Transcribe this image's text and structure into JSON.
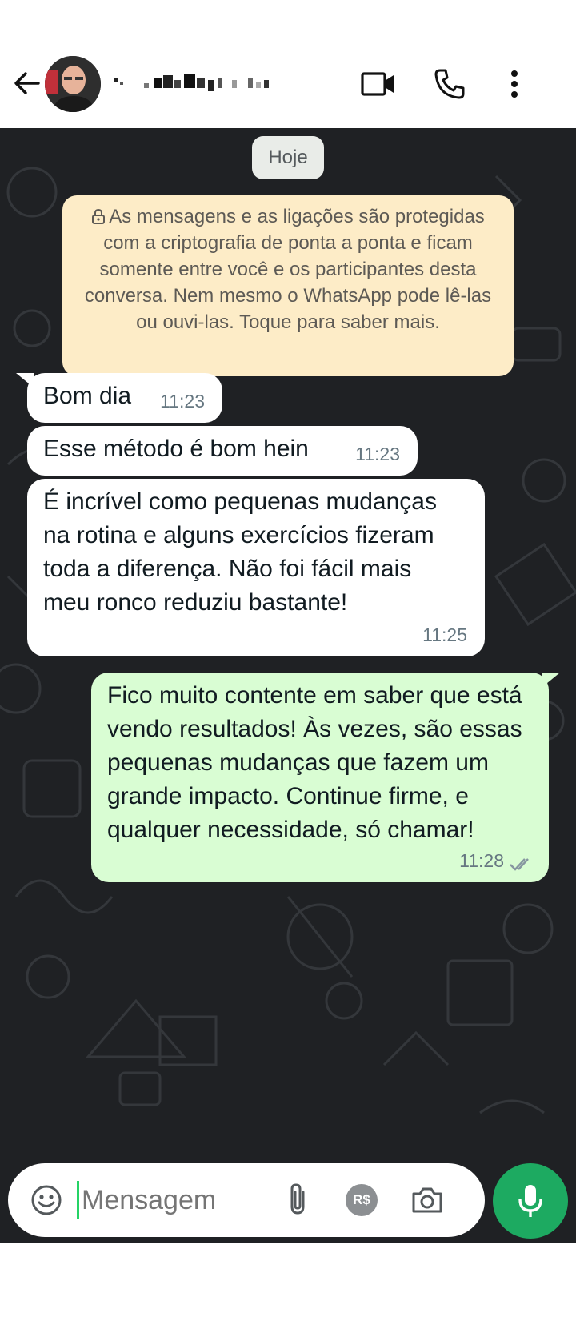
{
  "header": {
    "contact_name": "",
    "icons": [
      "back-arrow-icon",
      "video-call-icon",
      "phone-call-icon",
      "more-vert-icon"
    ]
  },
  "chat": {
    "date_label": "Hoje",
    "encryption_notice": "As mensagens e as ligações são protegidas com a criptografia de ponta a ponta e ficam somente entre você e os participantes desta conversa. Nem mesmo o WhatsApp pode lê-las ou ouvi-las. Toque para saber mais.",
    "messages": [
      {
        "direction": "in",
        "text": "Bom dia",
        "time": "11:23"
      },
      {
        "direction": "in",
        "text": "Esse método é bom hein",
        "time": "11:23"
      },
      {
        "direction": "in",
        "text": "É incrível como pequenas mudanças na rotina e alguns exercícios fizeram toda a diferença. Não foi fácil mais meu ronco reduziu bastante!",
        "time": "11:25"
      },
      {
        "direction": "out",
        "text": "Fico muito contente em saber que está vendo resultados! Às vezes, são essas pequenas mudanças que fazem um grande impacto. Continue firme, e qualquer necessidade, só chamar!",
        "time": "11:28",
        "status": "read"
      }
    ]
  },
  "composer": {
    "placeholder": "Mensagem",
    "icons": [
      "emoji-icon",
      "attach-icon",
      "payment-icon",
      "camera-icon",
      "mic-icon"
    ],
    "payment_label": "R$"
  },
  "colors": {
    "chat_bg": "#1f2124",
    "incoming_bubble": "#ffffff",
    "outgoing_bubble": "#d9fdd3",
    "notice_bg": "#fdecc7",
    "accent": "#1daa61"
  }
}
